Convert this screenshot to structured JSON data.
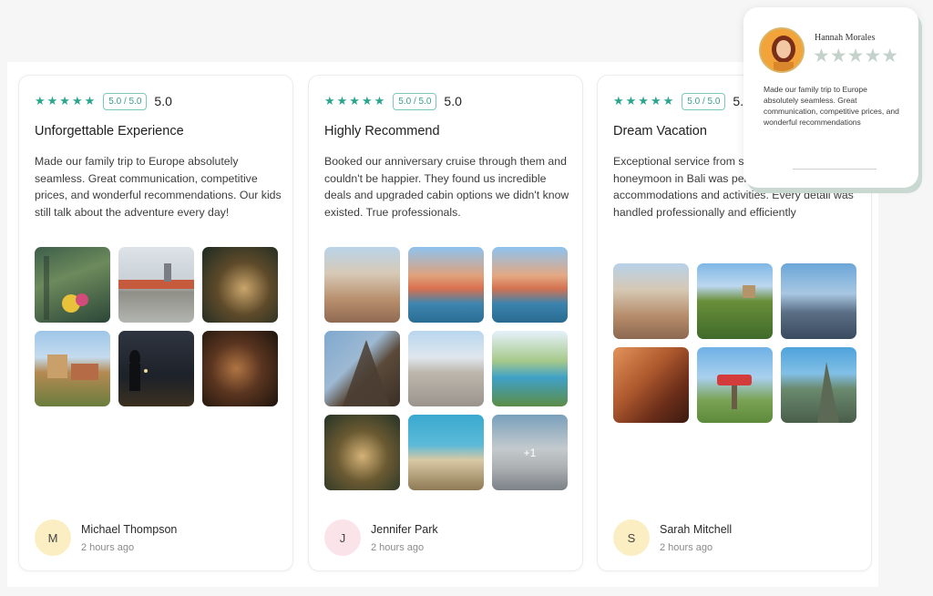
{
  "cards": [
    {
      "stars": "★★★★★",
      "badge": "5.0 / 5.0",
      "score": "5.0",
      "title": "Unforgettable Experience",
      "body": "Made our family trip to Europe absolutely seamless. Great communication, competitive prices, and wonderful recommendations. Our kids still talk about the adventure every day!",
      "author": "Michael Thompson",
      "initial": "M",
      "time": "2 hours ago",
      "avatar_color": "#fbeec2"
    },
    {
      "stars": "★★★★★",
      "badge": "5.0 / 5.0",
      "score": "5.0",
      "title": "Highly Recommend",
      "body": "Booked our anniversary cruise through them and couldn't be happier. They found us incredible deals and upgraded cabin options we didn't know existed. True professionals.",
      "author": "Jennifer Park",
      "initial": "J",
      "time": "2 hours ago",
      "avatar_color": "#fbe3ea",
      "more_label": "+1"
    },
    {
      "stars": "★★★★★",
      "badge": "5.0 / 5.0",
      "score": "5.0",
      "title": "Dream Vacation",
      "body": "Exceptional service from start to finish. Our honeymoon in Bali was perfect, with amazing accommodations and activities. Every detail was handled professionally and efficiently",
      "author": "Sarah Mitchell",
      "initial": "S",
      "time": "2 hours ago",
      "avatar_color": "#fbeec2"
    }
  ],
  "popup": {
    "name": "Hannah Morales",
    "stars": "★★★★★",
    "text": "Made our family trip to Europe absolutely seamless. Great communication, competitive prices, and wonderful recommendations"
  },
  "accent_color": "#2aa58e"
}
